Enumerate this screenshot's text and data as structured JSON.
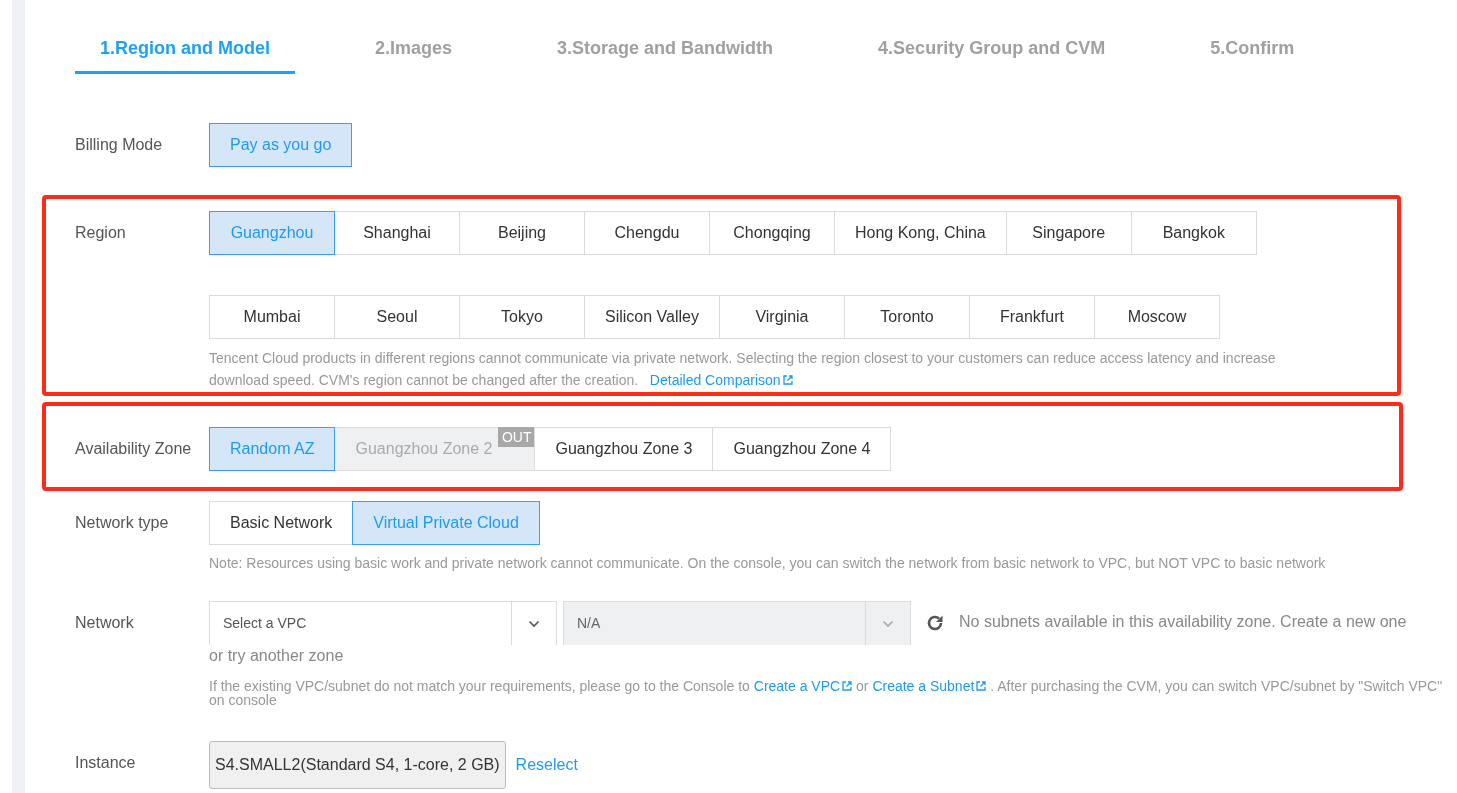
{
  "steps": [
    {
      "label": "1.Region and Model",
      "selected": true
    },
    {
      "label": "2.Images",
      "selected": false
    },
    {
      "label": "3.Storage and Bandwidth",
      "selected": false
    },
    {
      "label": "4.Security Group and CVM",
      "selected": false
    },
    {
      "label": "5.Confirm",
      "selected": false
    }
  ],
  "billing_mode": {
    "label": "Billing Mode",
    "options": [
      {
        "label": "Pay as you go",
        "selected": true
      }
    ]
  },
  "region": {
    "label": "Region",
    "highlighted": true,
    "rows": [
      [
        {
          "label": "Guangzhou",
          "selected": true
        },
        {
          "label": "Shanghai",
          "selected": false
        },
        {
          "label": "Beijing",
          "selected": false
        },
        {
          "label": "Chengdu",
          "selected": false
        },
        {
          "label": "Chongqing",
          "selected": false
        },
        {
          "label": "Hong Kong, China",
          "selected": false
        },
        {
          "label": "Singapore",
          "selected": false
        },
        {
          "label": "Bangkok",
          "selected": false
        }
      ],
      [
        {
          "label": "Mumbai",
          "selected": false
        },
        {
          "label": "Seoul",
          "selected": false
        },
        {
          "label": "Tokyo",
          "selected": false
        },
        {
          "label": "Silicon Valley",
          "selected": false
        },
        {
          "label": "Virginia",
          "selected": false
        },
        {
          "label": "Toronto",
          "selected": false
        },
        {
          "label": "Frankfurt",
          "selected": false
        },
        {
          "label": "Moscow",
          "selected": false
        }
      ]
    ],
    "hint": "Tencent Cloud products in different regions cannot communicate via private network. Selecting the region closest to your customers can reduce access latency and increase download speed. CVM's region cannot be changed after the creation.",
    "hint_link": "Detailed Comparison"
  },
  "availability_zone": {
    "label": "Availability Zone",
    "highlighted": true,
    "options": [
      {
        "label": "Random AZ",
        "selected": true,
        "disabled": false
      },
      {
        "label": "Guangzhou Zone 2",
        "selected": false,
        "disabled": true,
        "badge": "OUT"
      },
      {
        "label": "Guangzhou Zone 3",
        "selected": false,
        "disabled": false
      },
      {
        "label": "Guangzhou Zone 4",
        "selected": false,
        "disabled": false
      }
    ]
  },
  "network_type": {
    "label": "Network type",
    "options": [
      {
        "label": "Basic Network",
        "selected": false
      },
      {
        "label": "Virtual Private Cloud",
        "selected": true
      }
    ],
    "note": "Note: Resources using basic work and private network cannot communicate. On the console, you can switch the network from basic network to VPC, but NOT VPC to basic network"
  },
  "network": {
    "label": "Network",
    "vpc_select": {
      "value": "Select a VPC",
      "disabled": false
    },
    "subnet_select": {
      "value": "N/A",
      "disabled": true
    },
    "message": "No subnets available in this availability zone. Create a new one",
    "message_continued": "or try another zone",
    "hint_parts": [
      {
        "kind": "text",
        "text": "If the existing VPC/subnet do not match your requirements, please go to the Console to"
      },
      {
        "kind": "link",
        "text": "Create a VPC"
      },
      {
        "kind": "text",
        "text": "or"
      },
      {
        "kind": "link",
        "text": "Create a Subnet"
      },
      {
        "kind": "text",
        "text": ". After purchasing the CVM, you can switch VPC/subnet by \"Switch VPC\" on console"
      }
    ]
  },
  "instance": {
    "label": "Instance",
    "value": "S4.SMALL2(Standard S4, 1-core, 2 GB)",
    "action": "Reselect"
  }
}
